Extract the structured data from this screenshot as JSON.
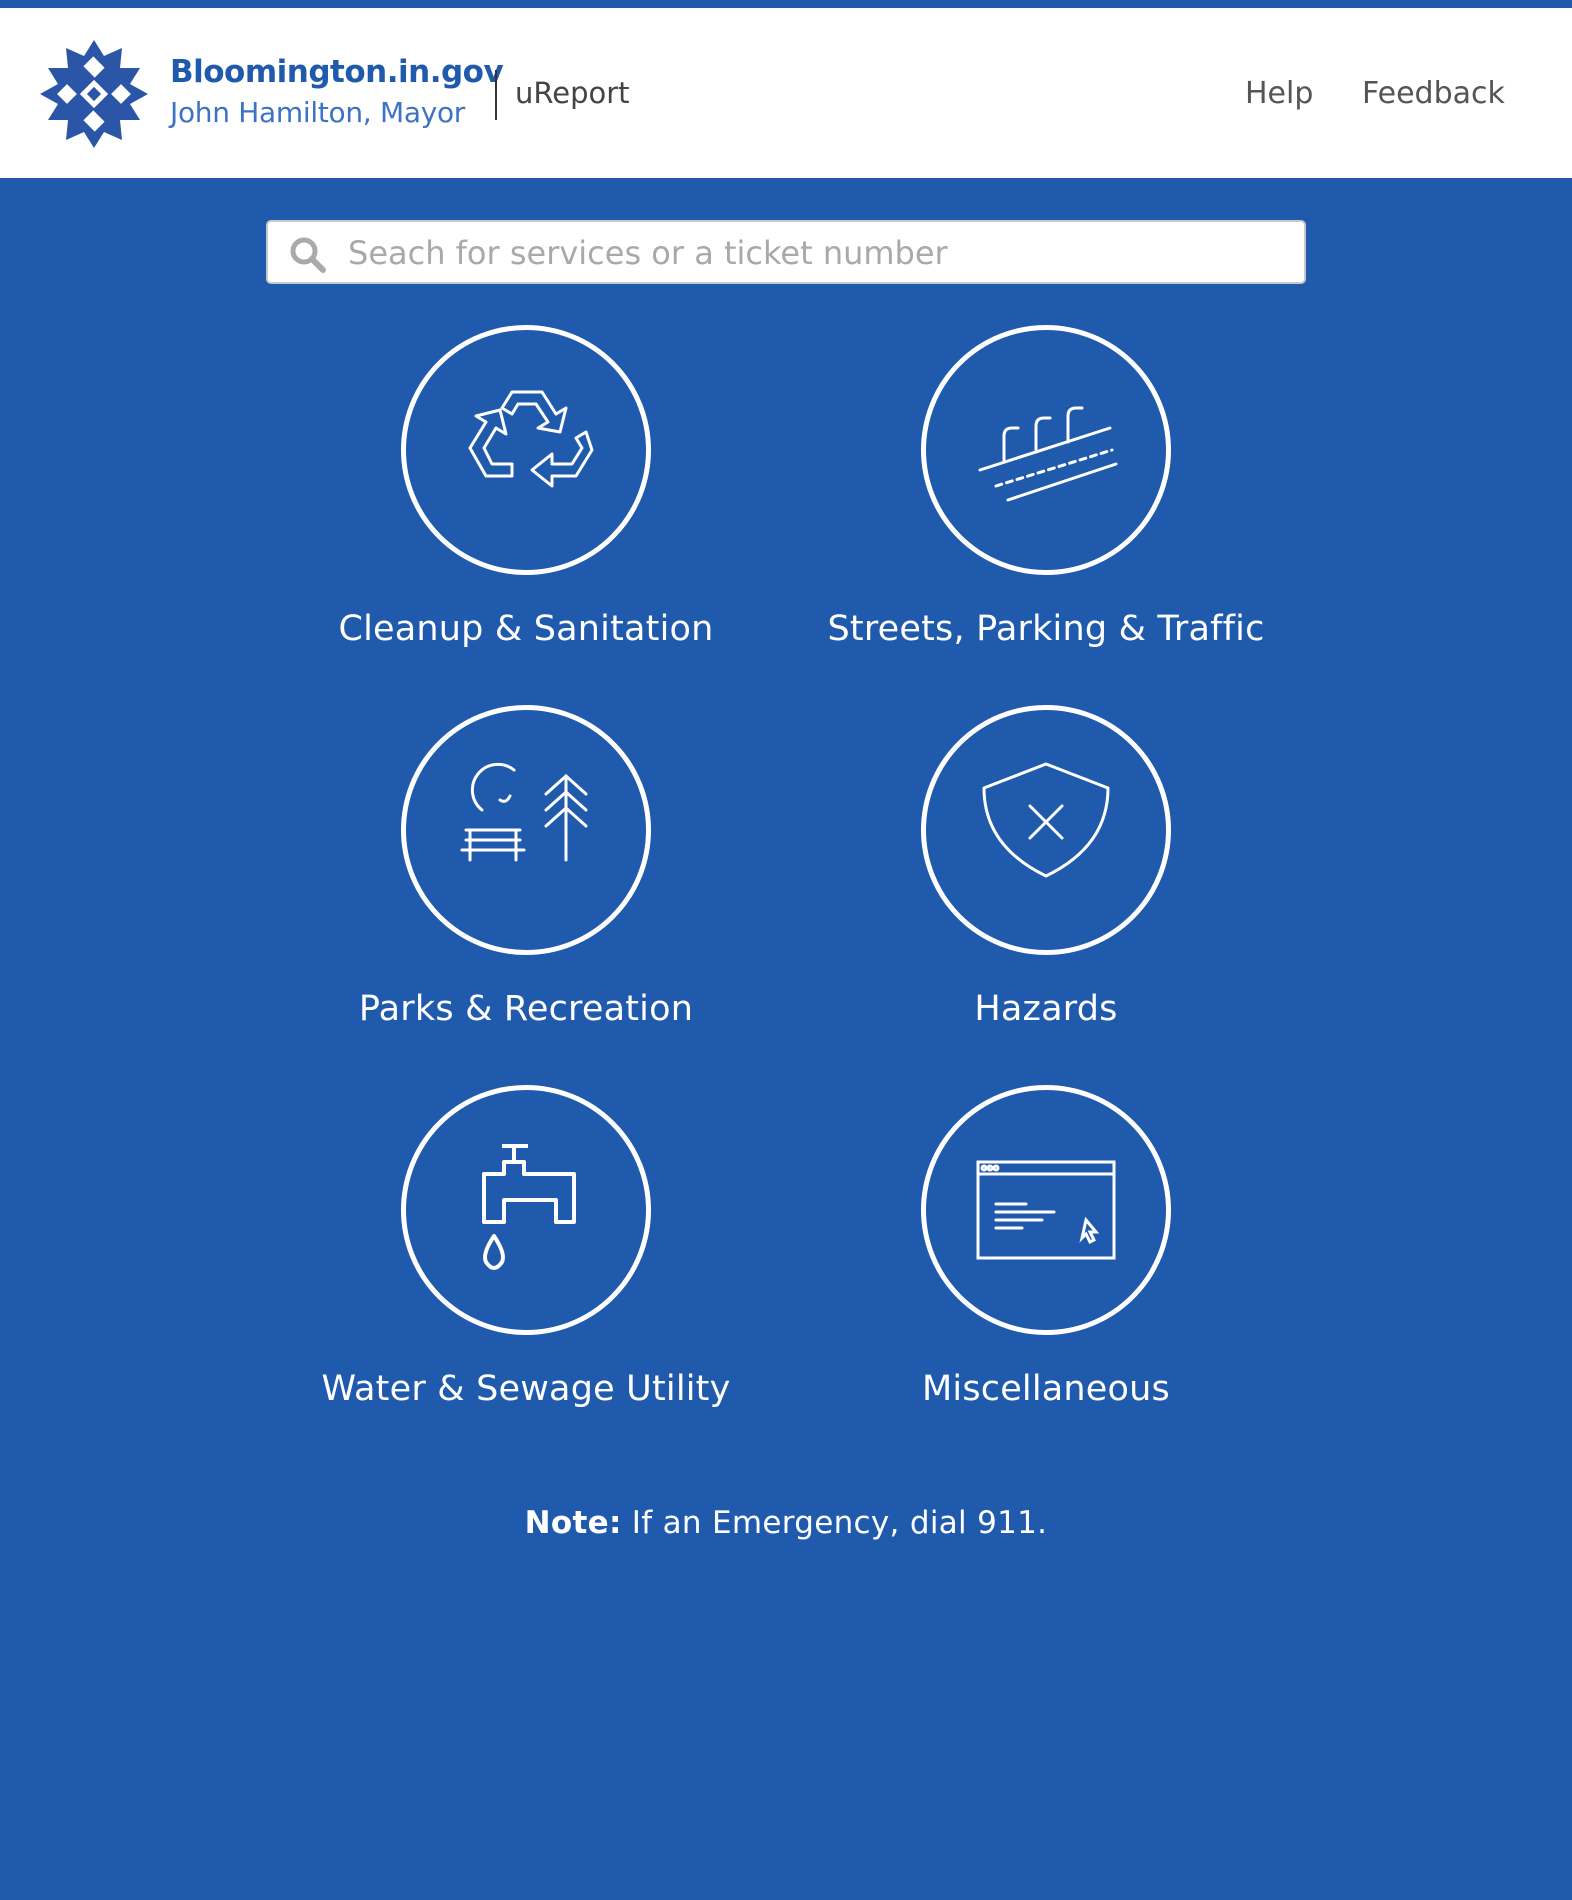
{
  "header": {
    "site_name": "Bloomington.in.gov",
    "mayor": "John Hamilton, Mayor",
    "app_name": "uReport",
    "nav": [
      {
        "label": "Help"
      },
      {
        "label": "Feedback"
      }
    ]
  },
  "search": {
    "placeholder": "Seach for services or a ticket number",
    "value": ""
  },
  "categories": [
    {
      "label": "Cleanup & Sanitation",
      "icon": "recycle-icon"
    },
    {
      "label": "Streets, Parking & Traffic",
      "icon": "street-icon"
    },
    {
      "label": "Parks & Recreation",
      "icon": "park-icon"
    },
    {
      "label": "Hazards",
      "icon": "shield-x-icon"
    },
    {
      "label": "Water & Sewage Utility",
      "icon": "faucet-icon"
    },
    {
      "label": "Miscellaneous",
      "icon": "browser-window-icon"
    }
  ],
  "note": {
    "prefix": "Note:",
    "text": " If an Emergency, dial 911."
  },
  "colors": {
    "brand_blue": "#1f5aad",
    "header_bg": "#ffffff",
    "icon_stroke": "#ffffff"
  }
}
